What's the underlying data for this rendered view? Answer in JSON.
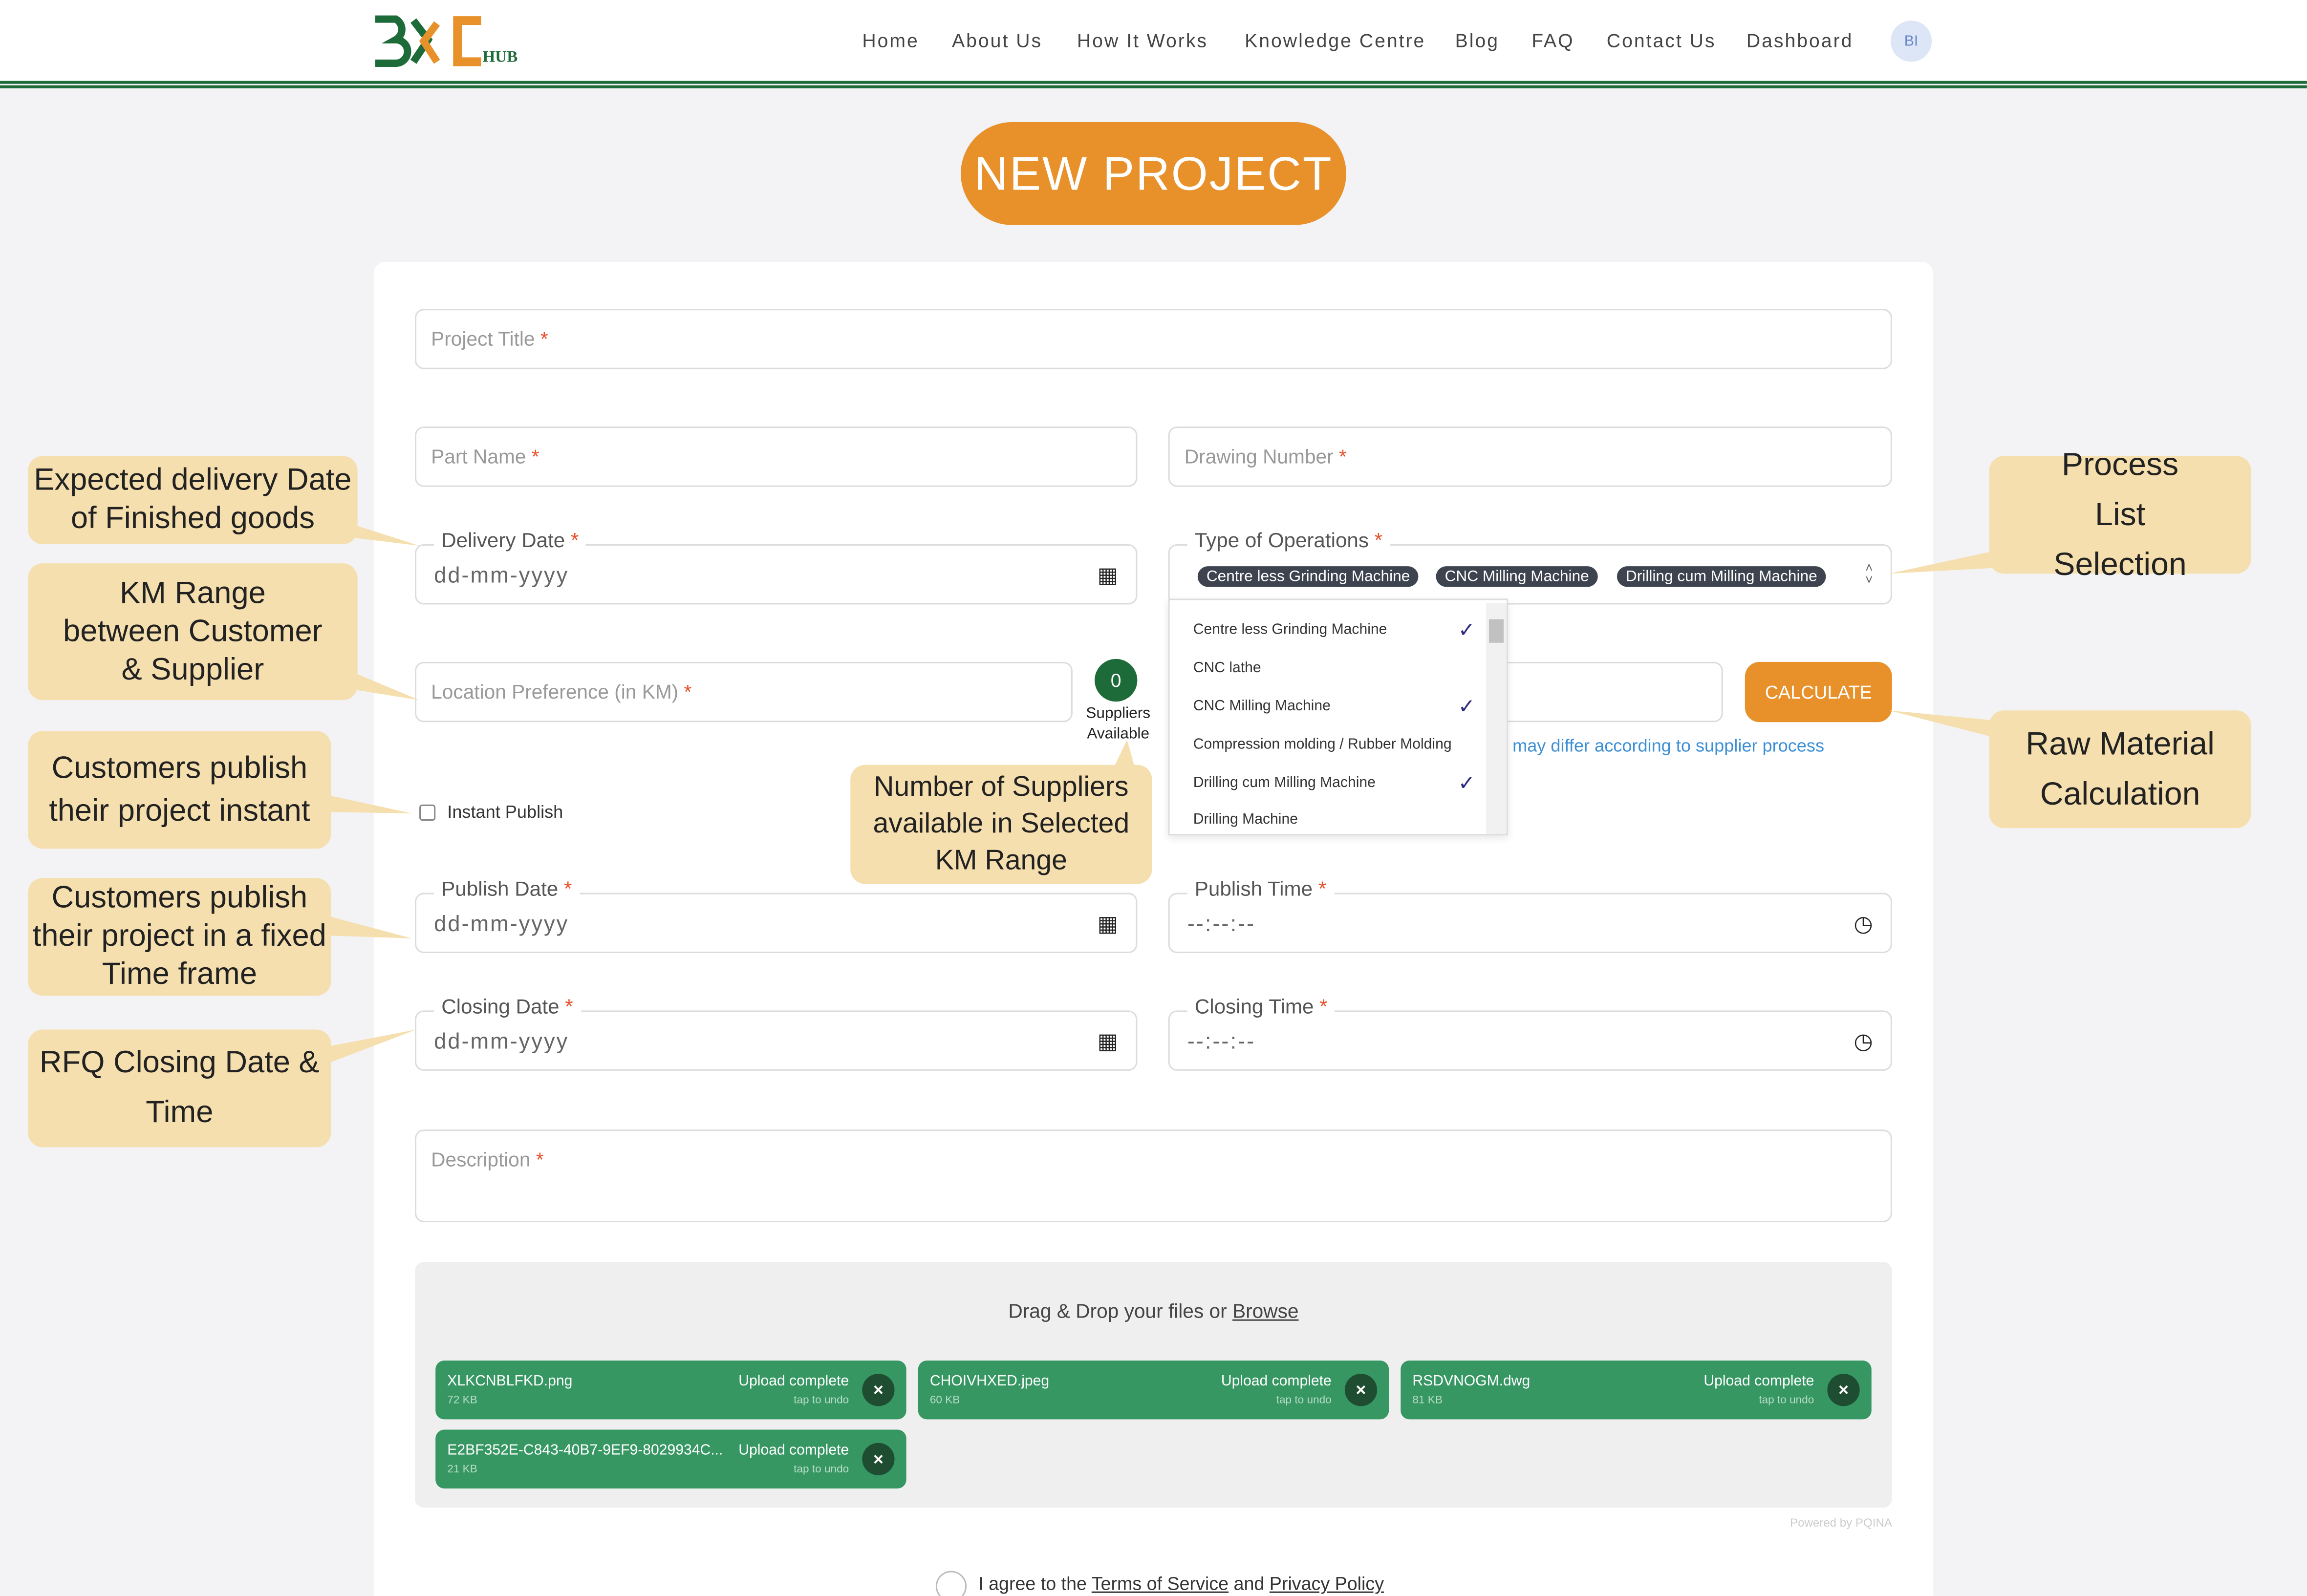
{
  "colors": {
    "brand_green": "#1e6b3a",
    "accent_orange": "#e8912a",
    "callout": "#f5dfae",
    "file_green": "#369763"
  },
  "logo": {
    "text": "B2B HUB"
  },
  "nav": {
    "items": [
      "Home",
      "About Us",
      "How It Works",
      "Knowledge Centre",
      "Blog",
      "FAQ",
      "Contact Us",
      "Dashboard"
    ],
    "avatar": "BI"
  },
  "page_title": "NEW PROJECT",
  "form": {
    "project_title": "Project Title",
    "part_name": "Part Name",
    "drawing_number": "Drawing Number",
    "delivery_date": {
      "label": "Delivery Date",
      "value": "dd-mm-yyyy"
    },
    "operations": {
      "label": "Type of Operations",
      "selected": [
        "Centre less Grinding Machine",
        "CNC Milling Machine",
        "Drilling cum Milling Machine"
      ],
      "options": [
        {
          "label": "Centre less Grinding Machine",
          "checked": true
        },
        {
          "label": "CNC lathe",
          "checked": false
        },
        {
          "label": "CNC Milling Machine",
          "checked": true
        },
        {
          "label": "Compression molding / Rubber Molding",
          "checked": false
        },
        {
          "label": "Drilling cum Milling Machine",
          "checked": true
        },
        {
          "label": "Drilling Machine",
          "checked": false
        }
      ]
    },
    "location": "Location Preference (in KM)",
    "suppliers_count": "0",
    "suppliers_label1": "Suppliers",
    "suppliers_label2": "Available",
    "calculate": "CALCULATE",
    "hint": "may differ according to supplier process",
    "instant_publish": "Instant Publish",
    "publish_date": {
      "label": "Publish Date",
      "value": "dd-mm-yyyy"
    },
    "publish_time": {
      "label": "Publish Time",
      "value": "--:--:--"
    },
    "closing_date": {
      "label": "Closing Date",
      "value": "dd-mm-yyyy"
    },
    "closing_time": {
      "label": "Closing Time",
      "value": "--:--:--"
    },
    "description": "Description",
    "required_mark": "*"
  },
  "upload": {
    "prompt": "Drag & Drop your files or ",
    "browse": "Browse",
    "powered": "Powered by PQINA",
    "files": [
      {
        "name": "XLKCNBLFKD.png",
        "size": "72 KB",
        "status": "Upload complete",
        "undo": "tap to undo"
      },
      {
        "name": "CHOIVHXED.jpeg",
        "size": "60 KB",
        "status": "Upload complete",
        "undo": "tap to undo"
      },
      {
        "name": "RSDVNOGM.dwg",
        "size": "81 KB",
        "status": "Upload complete",
        "undo": "tap to undo"
      },
      {
        "name": "E2BF352E-C843-40B7-9EF9-8029934C...",
        "size": "21 KB",
        "status": "Upload complete",
        "undo": "tap to undo"
      }
    ]
  },
  "agree": {
    "pre": "I agree to the ",
    "terms": "Terms of Service",
    "and": " and ",
    "privacy": "Privacy Policy"
  },
  "callouts": {
    "delivery": "Expected delivery Date of Finished goods",
    "km": "KM Range between Customer & Supplier",
    "instant": "Customers publish their project instant",
    "timeframe": "Customers publish their project in a fixed Time frame",
    "closing": "RFQ Closing Date & Time",
    "suppliers": "Number of Suppliers available in Selected KM Range",
    "process": "Process List Selection",
    "raw": "Raw Material Calculation"
  }
}
